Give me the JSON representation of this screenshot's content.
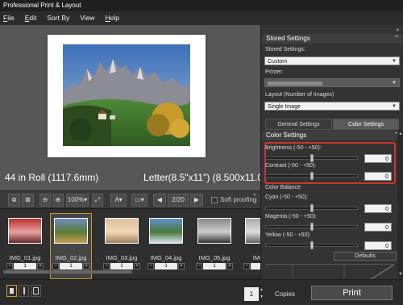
{
  "window": {
    "title": "Professional Print & Layout"
  },
  "menu": [
    {
      "ul": "F",
      "rest": "ile"
    },
    {
      "ul": "E",
      "rest": "dit"
    },
    {
      "ul": "",
      "rest": "Sort By"
    },
    {
      "ul": "",
      "rest": "View"
    },
    {
      "ul": "H",
      "rest": "elp"
    }
  ],
  "preview": {
    "roll_info": "44 in Roll (1117.6mm)",
    "paper_info": "Letter(8.5\"x11\") (8.500x11.000)"
  },
  "toolbar": {
    "zoom": "100%",
    "page_counter": "2/20",
    "soft_proofing_label": "Soft proofing",
    "soft_proofing_checked": false
  },
  "thumbnails": [
    {
      "name": "IMG_01.jpg",
      "copies": "1",
      "selected": false,
      "palette": [
        "#b8322e",
        "#e8a0a0",
        "#6a2a2a"
      ]
    },
    {
      "name": "IMG_02.jpg",
      "copies": "1",
      "selected": true,
      "palette": [
        "#6f8fc0",
        "#5a7a3a",
        "#c8a050"
      ]
    },
    {
      "name": "IMG_03.jpg",
      "copies": "1",
      "selected": false,
      "palette": [
        "#d8c0a0",
        "#f0d8b8",
        "#a08060"
      ]
    },
    {
      "name": "IMG_04.jpg",
      "copies": "1",
      "selected": false,
      "palette": [
        "#6090d0",
        "#4a7a3a",
        "#d8e0f0"
      ]
    },
    {
      "name": "IMG_05.jpg",
      "copies": "1",
      "selected": false,
      "palette": [
        "#888888",
        "#cccccc",
        "#333333"
      ]
    },
    {
      "name": "IMG_0",
      "copies": "1",
      "selected": false,
      "palette": [
        "#aaaaaa",
        "#dddddd",
        "#666666"
      ]
    }
  ],
  "status": {
    "copies_value": "1",
    "copies_label": "Copies",
    "print_label": "Print"
  },
  "panel": {
    "stored_settings_header": "Stored Settings",
    "stored_settings_label": "Stored Settings:",
    "stored_settings_value": "Custom",
    "printer_label": "Printer:",
    "printer_value": "",
    "layout_label": "Layout (Number of Images)",
    "layout_value": "Single Image",
    "tab_general": "General Settings",
    "tab_color": "Color Settings",
    "active_tab": "Color Settings",
    "color_settings_header": "Color Settings",
    "brightness_label": "Brightness (-50 - +50):",
    "brightness_value": "0",
    "contrast_label": "Contrast (-50 - +50):",
    "contrast_value": "0",
    "color_balance_label": "Color Balance",
    "cyan_label": "Cyan (-50 - +50):",
    "cyan_value": "0",
    "magenta_label": "Magenta (-50 - +50):",
    "magenta_value": "0",
    "yellow_label": "Yellow (-50 - +50):",
    "yellow_value": "0",
    "defaults_label": "Defaults"
  },
  "colors": {
    "highlight": "#d0342c",
    "selected_thumb": "#c8952e",
    "tab_active": "#5a5a5a"
  }
}
